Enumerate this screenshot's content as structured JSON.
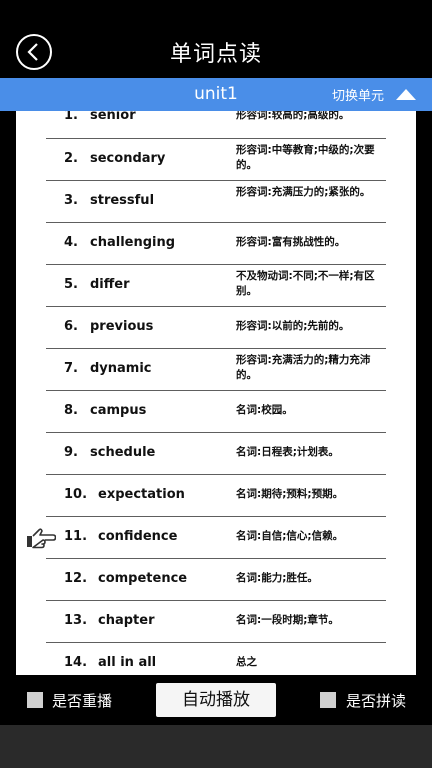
{
  "header": {
    "title": "单词点读",
    "back_icon": "chevron-left-icon"
  },
  "unit": {
    "name": "unit1",
    "switch_label": "切换单元",
    "switch_icon": "triangle-up-icon"
  },
  "words": [
    {
      "num": "1.",
      "word": "senior",
      "meaning": "形容词:较高的;高级的。"
    },
    {
      "num": "2.",
      "word": "secondary",
      "meaning": "形容词:中等教育;中级的;次要的。"
    },
    {
      "num": "3.",
      "word": "stressful",
      "meaning": "形容词:充满压力的;紧张的。"
    },
    {
      "num": "4.",
      "word": "challenging",
      "meaning": "形容词:富有挑战性的。"
    },
    {
      "num": "5.",
      "word": "differ",
      "meaning": "不及物动词:不同;不一样;有区别。"
    },
    {
      "num": "6.",
      "word": "previous",
      "meaning": "形容词:以前的;先前的。"
    },
    {
      "num": "7.",
      "word": "dynamic",
      "meaning": "形容词:充满活力的;精力充沛的。"
    },
    {
      "num": "8.",
      "word": "campus",
      "meaning": "名词:校园。"
    },
    {
      "num": "9.",
      "word": "schedule",
      "meaning": "名词:日程表;计划表。"
    },
    {
      "num": "10.",
      "word": "expectation",
      "meaning": "名词:期待;预料;预期。"
    },
    {
      "num": "11.",
      "word": "confidence",
      "meaning": "名词:自信;信心;信赖。"
    },
    {
      "num": "12.",
      "word": "competence",
      "meaning": "名词:能力;胜任。"
    },
    {
      "num": "13.",
      "word": "chapter",
      "meaning": "名词:一段时期;章节。"
    },
    {
      "num": "14.",
      "word": "all in all",
      "meaning": "总之"
    }
  ],
  "pointer_icon": "hand-pointer-icon",
  "controls": {
    "repeat_label": "是否重播",
    "auto_play_label": "自动播放",
    "spell_label": "是否拼读"
  }
}
